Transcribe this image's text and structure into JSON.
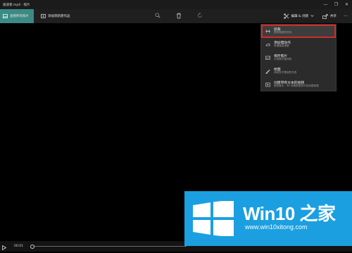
{
  "window": {
    "title": "极速者.mp4 - 照片",
    "minimize_glyph": "—",
    "maximize_glyph": "❐",
    "close_glyph": "✕"
  },
  "toolbar": {
    "view_all_photos": "查看所有照片",
    "add_to_creation": "添加到新建作品",
    "edit_create": "编辑 & 创建",
    "share": "共享",
    "more_glyph": "···"
  },
  "menu": {
    "items": [
      {
        "label": "剪裁",
        "desc": "更享视频的时刻",
        "icon": "trim-icon"
      },
      {
        "label": "添加慢动作",
        "desc": "放慢播放速度",
        "icon": "slow-motion-icon"
      },
      {
        "label": "保存照片",
        "desc": "从视频中保存帧",
        "icon": "save-photo-icon"
      },
      {
        "label": "绘图",
        "desc": "添加您才看到的东西",
        "icon": "draw-icon"
      },
      {
        "label": "创建带有文本的视频",
        "desc": "使用音乐、3D 效果和更多内容创建视频",
        "icon": "video-text-icon"
      }
    ],
    "selected_index": 0,
    "selected_outline_color": "#d22a2a"
  },
  "player": {
    "current_time": "00:01",
    "progress": 0.0
  },
  "watermark": {
    "brand": "Win10 之家",
    "url": "www.win10xitong.com",
    "background": "#1b9fe0"
  }
}
